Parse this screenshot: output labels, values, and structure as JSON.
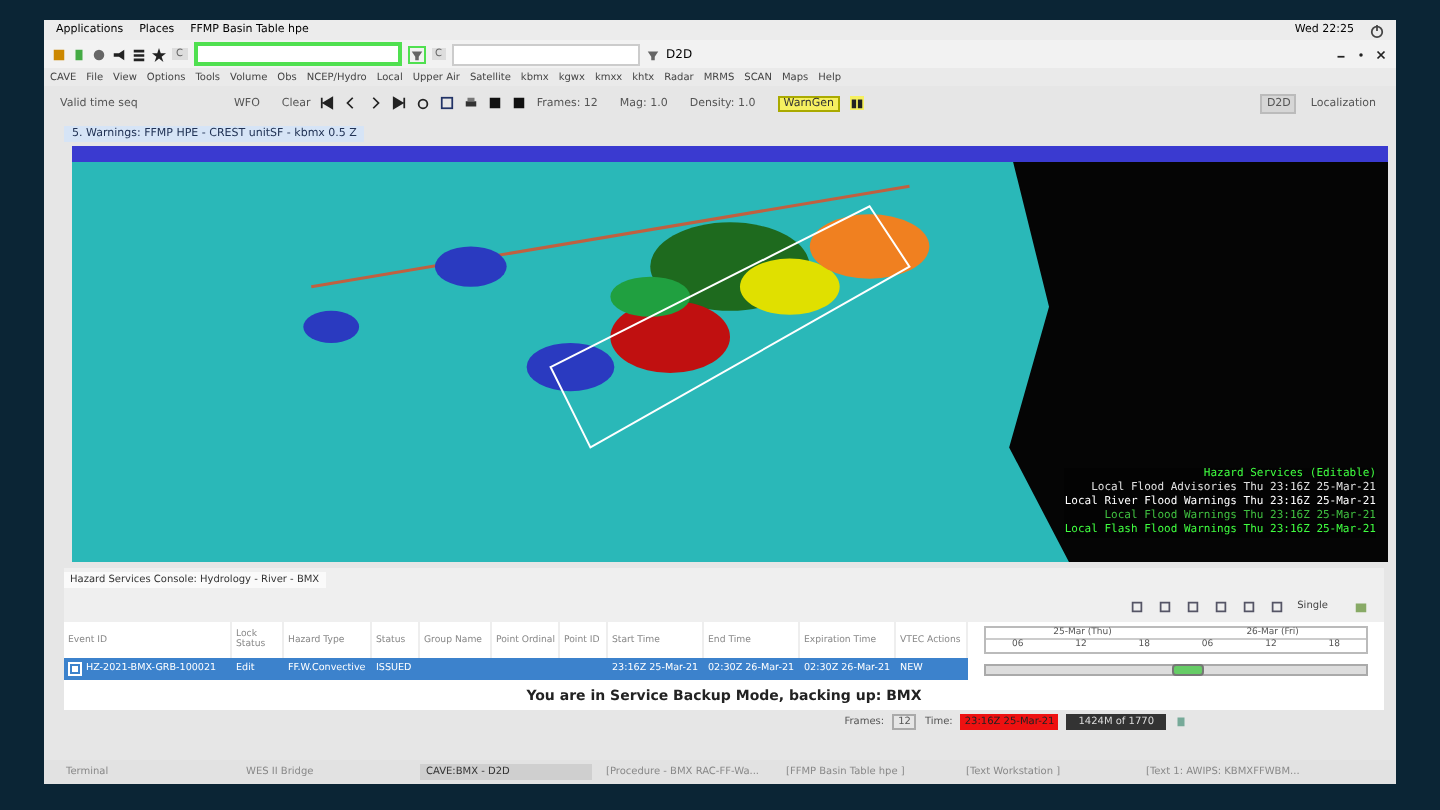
{
  "top_bar": {
    "menus": [
      "Applications",
      "Places",
      "FFMP Basin Table hpe"
    ],
    "clock": "Wed 22:25"
  },
  "title_bar": {
    "title": "D2D",
    "combo_labels": [
      "C",
      "C"
    ]
  },
  "menu_bar": [
    "CAVE",
    "File",
    "View",
    "Options",
    "Tools",
    "Volume",
    "Obs",
    "NCEP/Hydro",
    "Local",
    "Upper Air",
    "Satellite",
    "kbmx",
    "kgwx",
    "kmxx",
    "khtx",
    "Radar",
    "MRMS",
    "SCAN",
    "Maps",
    "Help"
  ],
  "toolbar": {
    "valid_time": "Valid time seq",
    "wfo": "WFO",
    "clear": "Clear",
    "frames": "Frames: 12",
    "mag": "Mag: 1.0",
    "density": "Density: 1.0",
    "warngen": "WarnGen",
    "perspectives": [
      {
        "label": "D2D",
        "selected": true
      },
      {
        "label": "Localization",
        "selected": false
      }
    ]
  },
  "editor_tab": {
    "title": "5. Warnings: FFMP HPE - CREST unitSF - kbmx 0.5 Z"
  },
  "map": {
    "legend": [
      {
        "text": "Hazard Services (Editable)",
        "color": "#40ff40"
      },
      {
        "text": "Local Flood Advisories Thu 23:16Z 25-Mar-21",
        "color": "#e0e0e0"
      },
      {
        "text": "Local River Flood Warnings Thu 23:16Z 25-Mar-21",
        "color": "#ffffff"
      },
      {
        "text": "Local Flood Warnings Thu 23:16Z 25-Mar-21",
        "color": "#40c040"
      },
      {
        "text": "Local Flash Flood Warnings Thu 23:16Z 25-Mar-21",
        "color": "#40ff40"
      }
    ]
  },
  "hazard_console": {
    "title": "Hazard Services Console: Hydrology - River - BMX",
    "mode": "Single",
    "columns": [
      "Event ID",
      "Lock Status",
      "Hazard Type",
      "Status",
      "Group Name",
      "Point Ordinal",
      "Point ID",
      "Start Time",
      "End Time",
      "Expiration Time",
      "VTEC Actions"
    ],
    "rows": [
      {
        "selected": true,
        "checked": true,
        "event_id": "HZ-2021-BMX-GRB-100021",
        "lock_status": "Edit",
        "hazard_type": "FF.W.Convective",
        "status": "ISSUED",
        "start_time": "23:16Z 25-Mar-21",
        "end_time": "02:30Z 26-Mar-21",
        "expiration_time": "02:30Z 26-Mar-21",
        "vtec_actions": "NEW"
      }
    ],
    "timeline": {
      "level": 0.49,
      "days": [
        "25-Mar (Thu)",
        "26-Mar (Fri)"
      ],
      "hours": [
        "06",
        "12",
        "18",
        "06",
        "12",
        "18"
      ]
    },
    "banner": "You are in Service Backup Mode, backing up: BMX"
  },
  "status": {
    "frames_label": "Frames:",
    "frames": "12",
    "time_label": "Time:",
    "time": "23:16Z 25-Mar-21",
    "memory": "1424M of 1770"
  },
  "taskbar": [
    {
      "label": "Terminal",
      "selected": false
    },
    {
      "label": "WES II Bridge",
      "selected": false
    },
    {
      "label": "CAVE:BMX - D2D",
      "selected": true
    },
    {
      "label": "[Procedure - BMX RAC-FF-Wa...",
      "selected": false
    },
    {
      "label": "[FFMP Basin Table hpe ]",
      "selected": false
    },
    {
      "label": "[Text Workstation ]",
      "selected": false
    },
    {
      "label": "[Text 1: AWIPS: KBMXFFWBM...",
      "selected": false
    }
  ]
}
